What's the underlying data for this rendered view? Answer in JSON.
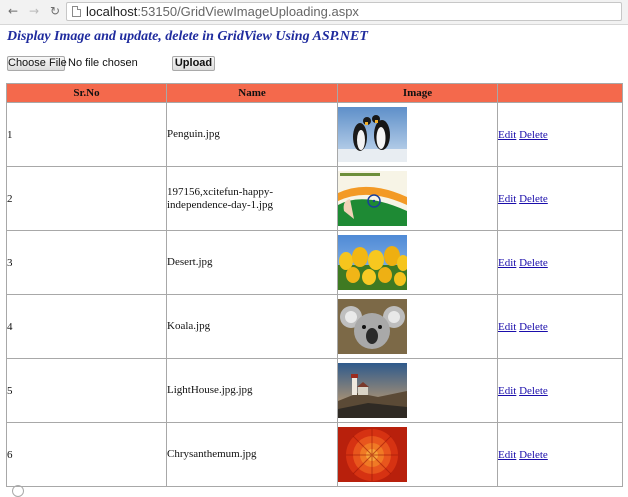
{
  "browser": {
    "url_host": "localhost",
    "url_path": ":53150/GridViewImageUploading.aspx"
  },
  "page": {
    "title": "Display Image and update, delete in GridView Using ASP.NET"
  },
  "upload": {
    "choose_label": "Choose File",
    "status": "No file chosen",
    "upload_label": "Upload"
  },
  "grid": {
    "headers": [
      "Sr.No",
      "Name",
      "Image",
      ""
    ],
    "header_color": "#f4694c",
    "rows": [
      {
        "sr": "1",
        "name": "Penguin.jpg",
        "image": "penguins",
        "edit": "Edit",
        "delete": "Delete"
      },
      {
        "sr": "2",
        "name": "197156,xcitefun-happy-independence-day-1.jpg",
        "image": "independence-day-flag",
        "edit": "Edit",
        "delete": "Delete"
      },
      {
        "sr": "3",
        "name": "Desert.jpg",
        "image": "yellow-tulips",
        "edit": "Edit",
        "delete": "Delete"
      },
      {
        "sr": "4",
        "name": "Koala.jpg",
        "image": "koala",
        "edit": "Edit",
        "delete": "Delete"
      },
      {
        "sr": "5",
        "name": "LightHouse.jpg.jpg",
        "image": "lighthouse",
        "edit": "Edit",
        "delete": "Delete"
      },
      {
        "sr": "6",
        "name": "Chrysanthemum.jpg",
        "image": "chrysanthemum",
        "edit": "Edit",
        "delete": "Delete"
      }
    ]
  }
}
